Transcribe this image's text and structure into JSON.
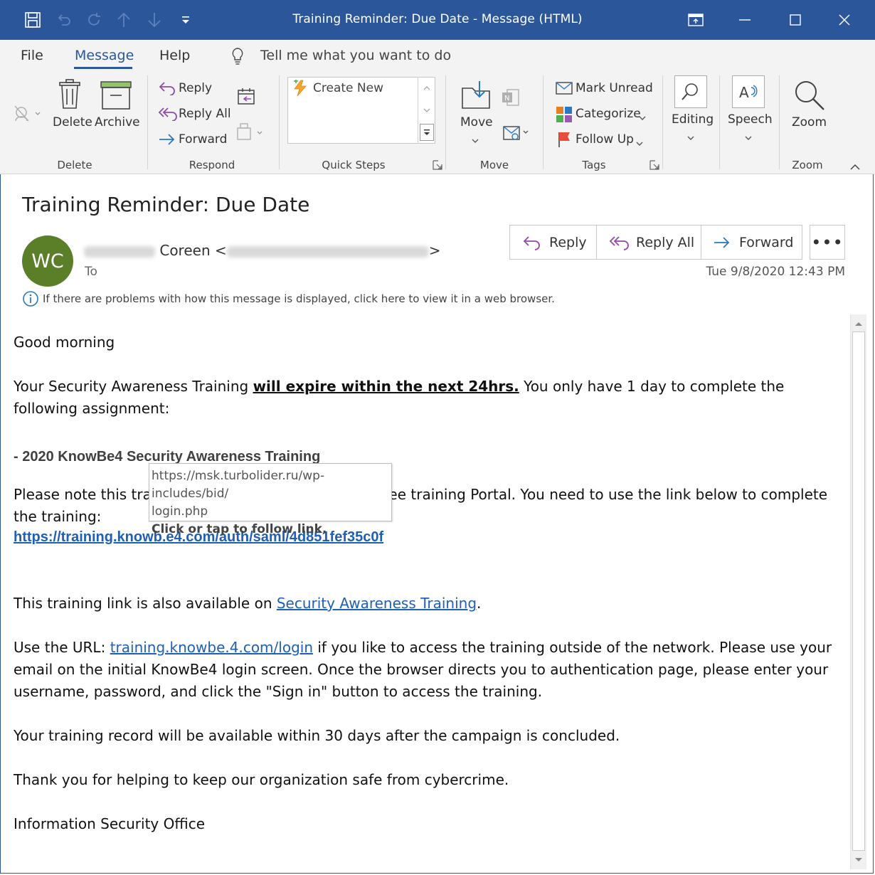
{
  "window": {
    "title": "Training Reminder: Due Date  -  Message (HTML)"
  },
  "menu": {
    "file": "File",
    "message": "Message",
    "help": "Help",
    "tell_me": "Tell me what you want to do"
  },
  "ribbon": {
    "delete_group": {
      "delete": "Delete",
      "archive": "Archive",
      "label": "Delete"
    },
    "respond_group": {
      "reply": "Reply",
      "reply_all": "Reply All",
      "forward": "Forward",
      "label": "Respond"
    },
    "quick_steps": {
      "create_new": "Create New",
      "label": "Quick Steps"
    },
    "move_group": {
      "move": "Move",
      "label": "Move"
    },
    "tags_group": {
      "mark_unread": "Mark Unread",
      "categorize": "Categorize",
      "follow_up": "Follow Up",
      "label": "Tags"
    },
    "editing": "Editing",
    "speech": "Speech",
    "zoom": "Zoom",
    "zoom_label": "Zoom"
  },
  "message": {
    "subject": "Training Reminder: Due Date",
    "avatar_initials": "WC",
    "sender_name": "Coreen",
    "sender_open": "<",
    "sender_close": ">",
    "to_label": "To",
    "datetime": "Tue 9/8/2020 12:43 PM",
    "actions": {
      "reply": "Reply",
      "reply_all": "Reply All",
      "forward": "Forward",
      "more": "•••"
    },
    "info_text": "If there are problems with how this message is displayed, click here to view it in a web browser."
  },
  "body": {
    "greeting": "Good morning",
    "p1_pre": "Your Security Awareness Training ",
    "p1_emph": "will expire within the next 24hrs.",
    "p1_post": " You only have 1 day to complete the following assignment:",
    "training_title": "- 2020 KnowBe4 Security Awareness Training",
    "p2_pre": "Please note this trai",
    "p2_post": "ee training Portal. You need to use the link below to complete",
    "p2_line2": "the training:",
    "link_main": "https://training.knowb.e4.com/auth/saml/4d851fef35c0f",
    "p3_pre": "This training link is also available on ",
    "p3_link": "Security Awareness Training",
    "p3_post": ".",
    "p4_pre": "Use the URL: ",
    "p4_link": "training.knowbe.4.com/login",
    "p4_post": " if you like to access the training outside of the network. Please use your email on the initial KnowBe4 login screen. Once the browser directs you to authentication page, please enter your username, password, and click the \"Sign in\" button to access the training.",
    "p5": "Your training record will be available within 30 days after the campaign is concluded.",
    "p6": "Thank you for helping to keep our organization safe from cybercrime.",
    "signature": "Information Security Office"
  },
  "tooltip": {
    "url_line1": "https://msk.turbolider.ru/wp-includes/bid/",
    "url_line2": "login.php",
    "cta": "Click or tap to follow link."
  },
  "colors": {
    "title_bar": "#2b579a",
    "avatar": "#5b7e29",
    "link": "#1f5fb5"
  }
}
